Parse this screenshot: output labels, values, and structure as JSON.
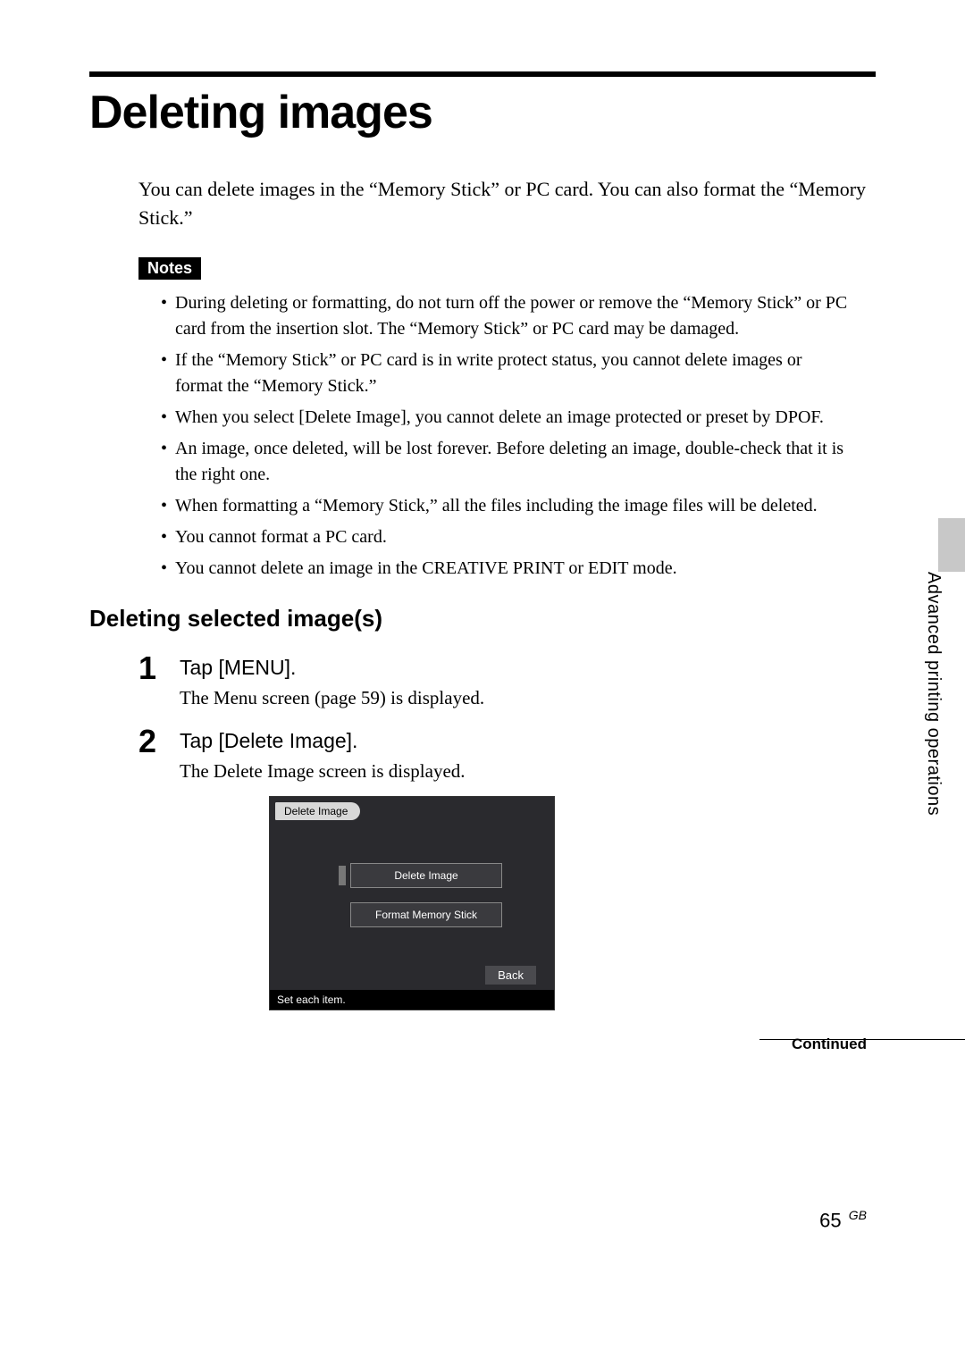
{
  "header": {
    "title": "Deleting images"
  },
  "intro": "You can delete images in the “Memory Stick” or PC card. You can also format the “Memory Stick.”",
  "notes": {
    "label": "Notes",
    "items": [
      "During deleting or formatting, do not turn off the power or remove the “Memory Stick” or PC card from the insertion slot.  The “Memory Stick” or PC card may be damaged.",
      "If the “Memory Stick” or PC card is in write protect status, you cannot delete images or format the “Memory Stick.”",
      "When you select [Delete Image], you cannot delete an image protected or preset by DPOF.",
      "An image, once deleted, will be lost forever. Before deleting an image, double-check that it is the right one.",
      "When formatting a “Memory Stick,” all the files including the image files will be deleted.",
      "You cannot format a PC card.",
      "You cannot delete an image in the CREATIVE PRINT or EDIT mode."
    ]
  },
  "subhead": "Deleting selected image(s)",
  "steps": [
    {
      "num": "1",
      "title": "Tap [MENU].",
      "desc": "The Menu screen (page 59) is displayed."
    },
    {
      "num": "2",
      "title": "Tap [Delete Image].",
      "desc": "The Delete Image screen is displayed."
    }
  ],
  "screenshot": {
    "tag": "Delete Image",
    "option1": "Delete Image",
    "option2": "Format Memory Stick",
    "back": "Back",
    "footer": "Set each item."
  },
  "side": {
    "label": "Advanced printing operations"
  },
  "continued": "Continued",
  "footer": {
    "page": "65",
    "region": "GB"
  }
}
